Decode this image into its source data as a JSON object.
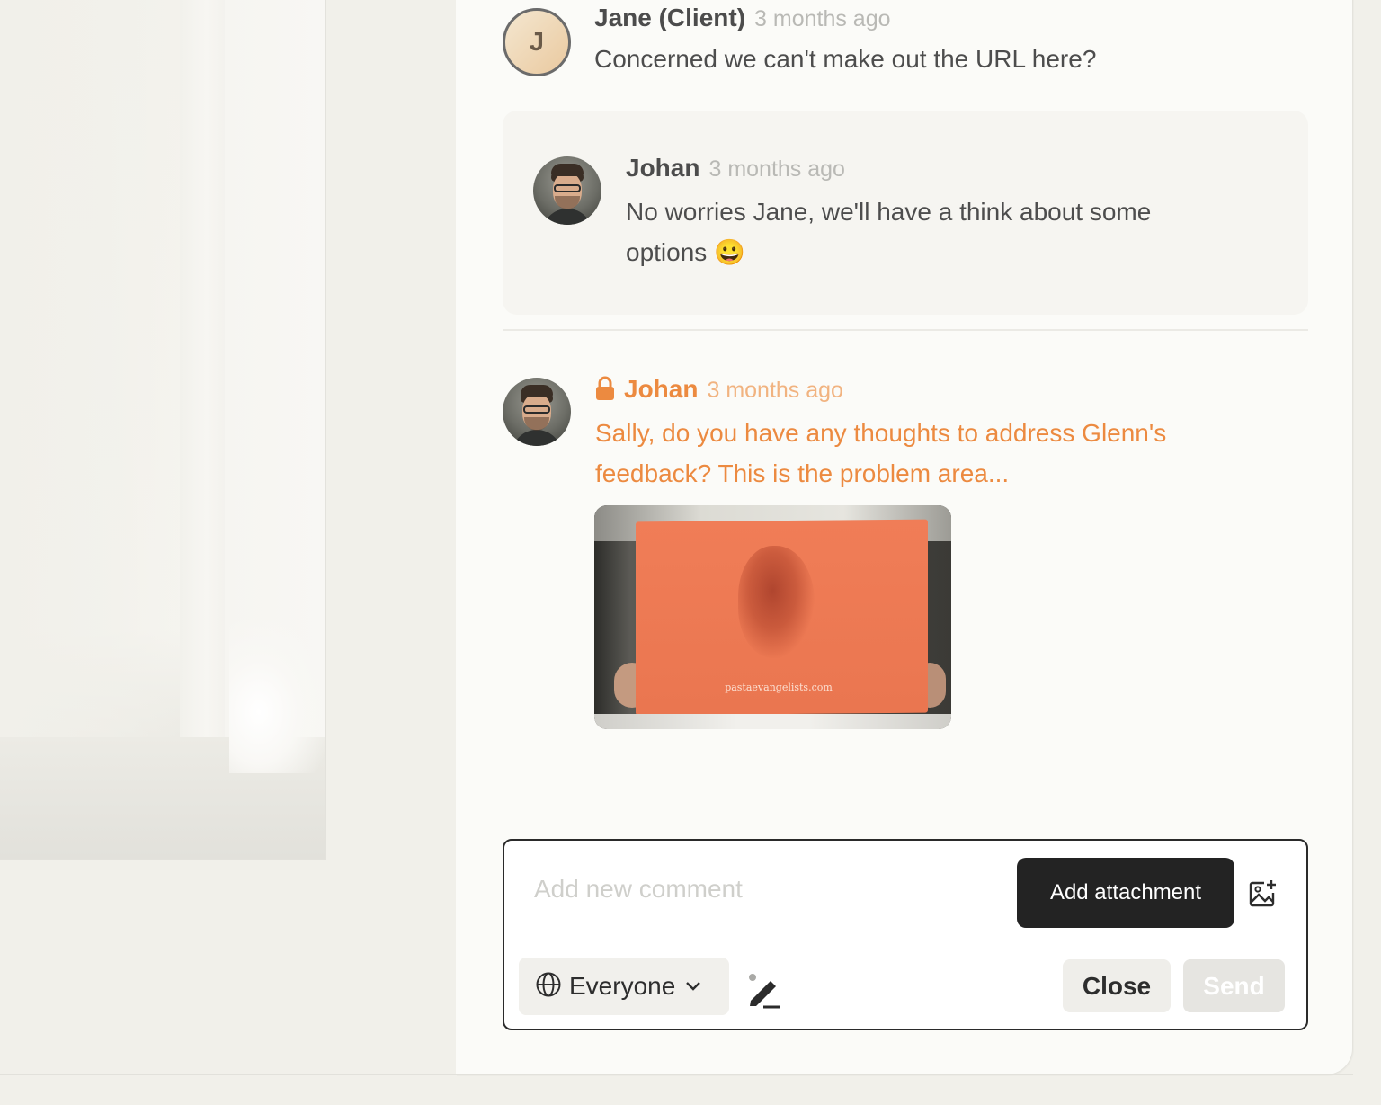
{
  "comments": [
    {
      "author": "Jane (Client)",
      "time": "3 months ago",
      "text": "Concerned we can't make out the URL here?",
      "avatar_initial": "J"
    },
    {
      "author": "Johan",
      "time": "3 months ago",
      "text": "No worries Jane, we'll have a think about some options 😀",
      "avatar": "user-photo"
    },
    {
      "author": "Johan",
      "time": "3 months ago",
      "text": "Sally, do you have any thoughts to address Glenn's feedback? This is the problem area...",
      "private": true,
      "avatar": "user-photo",
      "attachment": {
        "type": "image",
        "caption_on_box": "pastaevangelists.com"
      }
    }
  ],
  "composer": {
    "placeholder": "Add new comment",
    "add_attachment_label": "Add attachment",
    "visibility_label": "Everyone",
    "close_label": "Close",
    "send_label": "Send"
  },
  "icons": {
    "lock": "lock-icon",
    "image_add": "image-add-icon",
    "globe": "globe-icon",
    "chevron": "chevron-down-icon",
    "pen": "pen-tool-icon"
  },
  "colors": {
    "private_accent": "#ec8a40",
    "primary_button": "#232323",
    "send_disabled": "#e6e5e1"
  }
}
